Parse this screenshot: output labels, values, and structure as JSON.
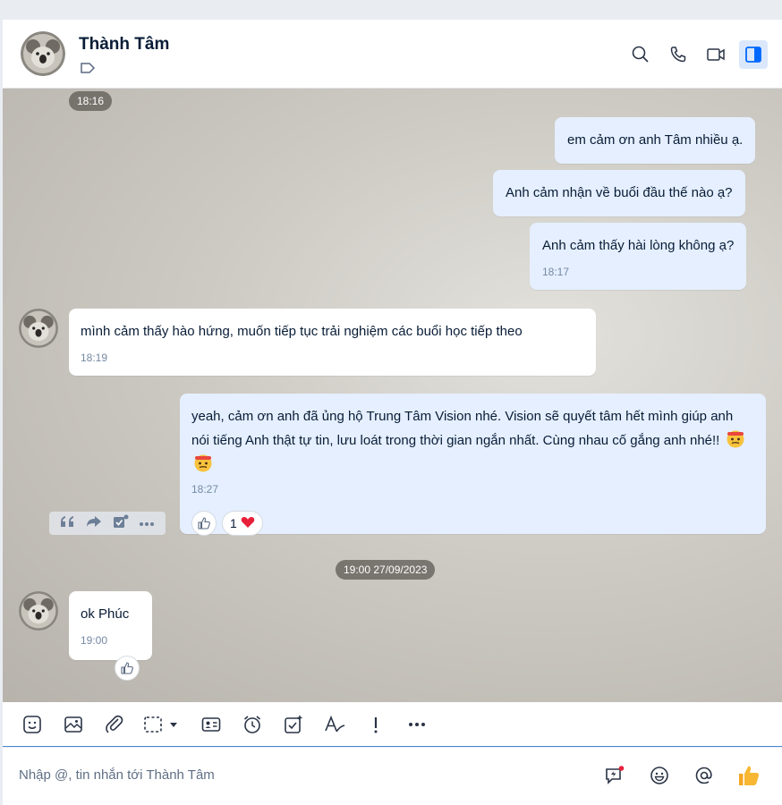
{
  "header": {
    "name": "Thành Tâm",
    "icons": [
      "search-icon",
      "phone-icon",
      "video-call-icon",
      "sidebar-toggle-icon"
    ]
  },
  "messages": {
    "t1": "18:16",
    "m1": "em cảm ơn anh Tâm nhiều ạ.",
    "m2": "Anh cảm nhận về buổi đầu thế nào ạ?",
    "m3": "Anh cảm thấy hài lòng không ạ?",
    "m3_time": "18:17",
    "m4": "mình cảm thấy hào hứng, muốn tiếp tục trải nghiệm các buổi học tiếp theo",
    "m4_time": "18:19",
    "m5": "yeah, cảm ơn anh đã ủng hộ Trung Tâm Vision nhé. Vision sẽ quyết tâm hết mình giúp anh nói tiếng Anh thật tự tin, lưu loát trong thời gian ngắn nhất. Cùng nhau cố gắng anh nhé!!",
    "m5_time": "18:27",
    "m5_reaction_count": "1",
    "t2": "19:00 27/09/2023",
    "m6": "ok Phúc",
    "m6_time": "19:00"
  },
  "colors": {
    "my_bubble": "#e5efff",
    "their_bubble": "#ffffff",
    "accent": "#0068ff",
    "heart": "#e8203a"
  },
  "toolbar": {
    "icons": [
      "sticker-icon",
      "image-icon",
      "attachment-icon",
      "screenshot-icon",
      "contact-card-icon",
      "reminder-clock-icon",
      "task-icon",
      "text-format-icon",
      "urgent-icon",
      "more-icon"
    ]
  },
  "composer": {
    "placeholder": "Nhập @, tin nhắn tới Thành Tâm",
    "icons": [
      "quick-message-icon",
      "emoji-icon",
      "mention-icon",
      "thumbs-up-icon"
    ]
  }
}
